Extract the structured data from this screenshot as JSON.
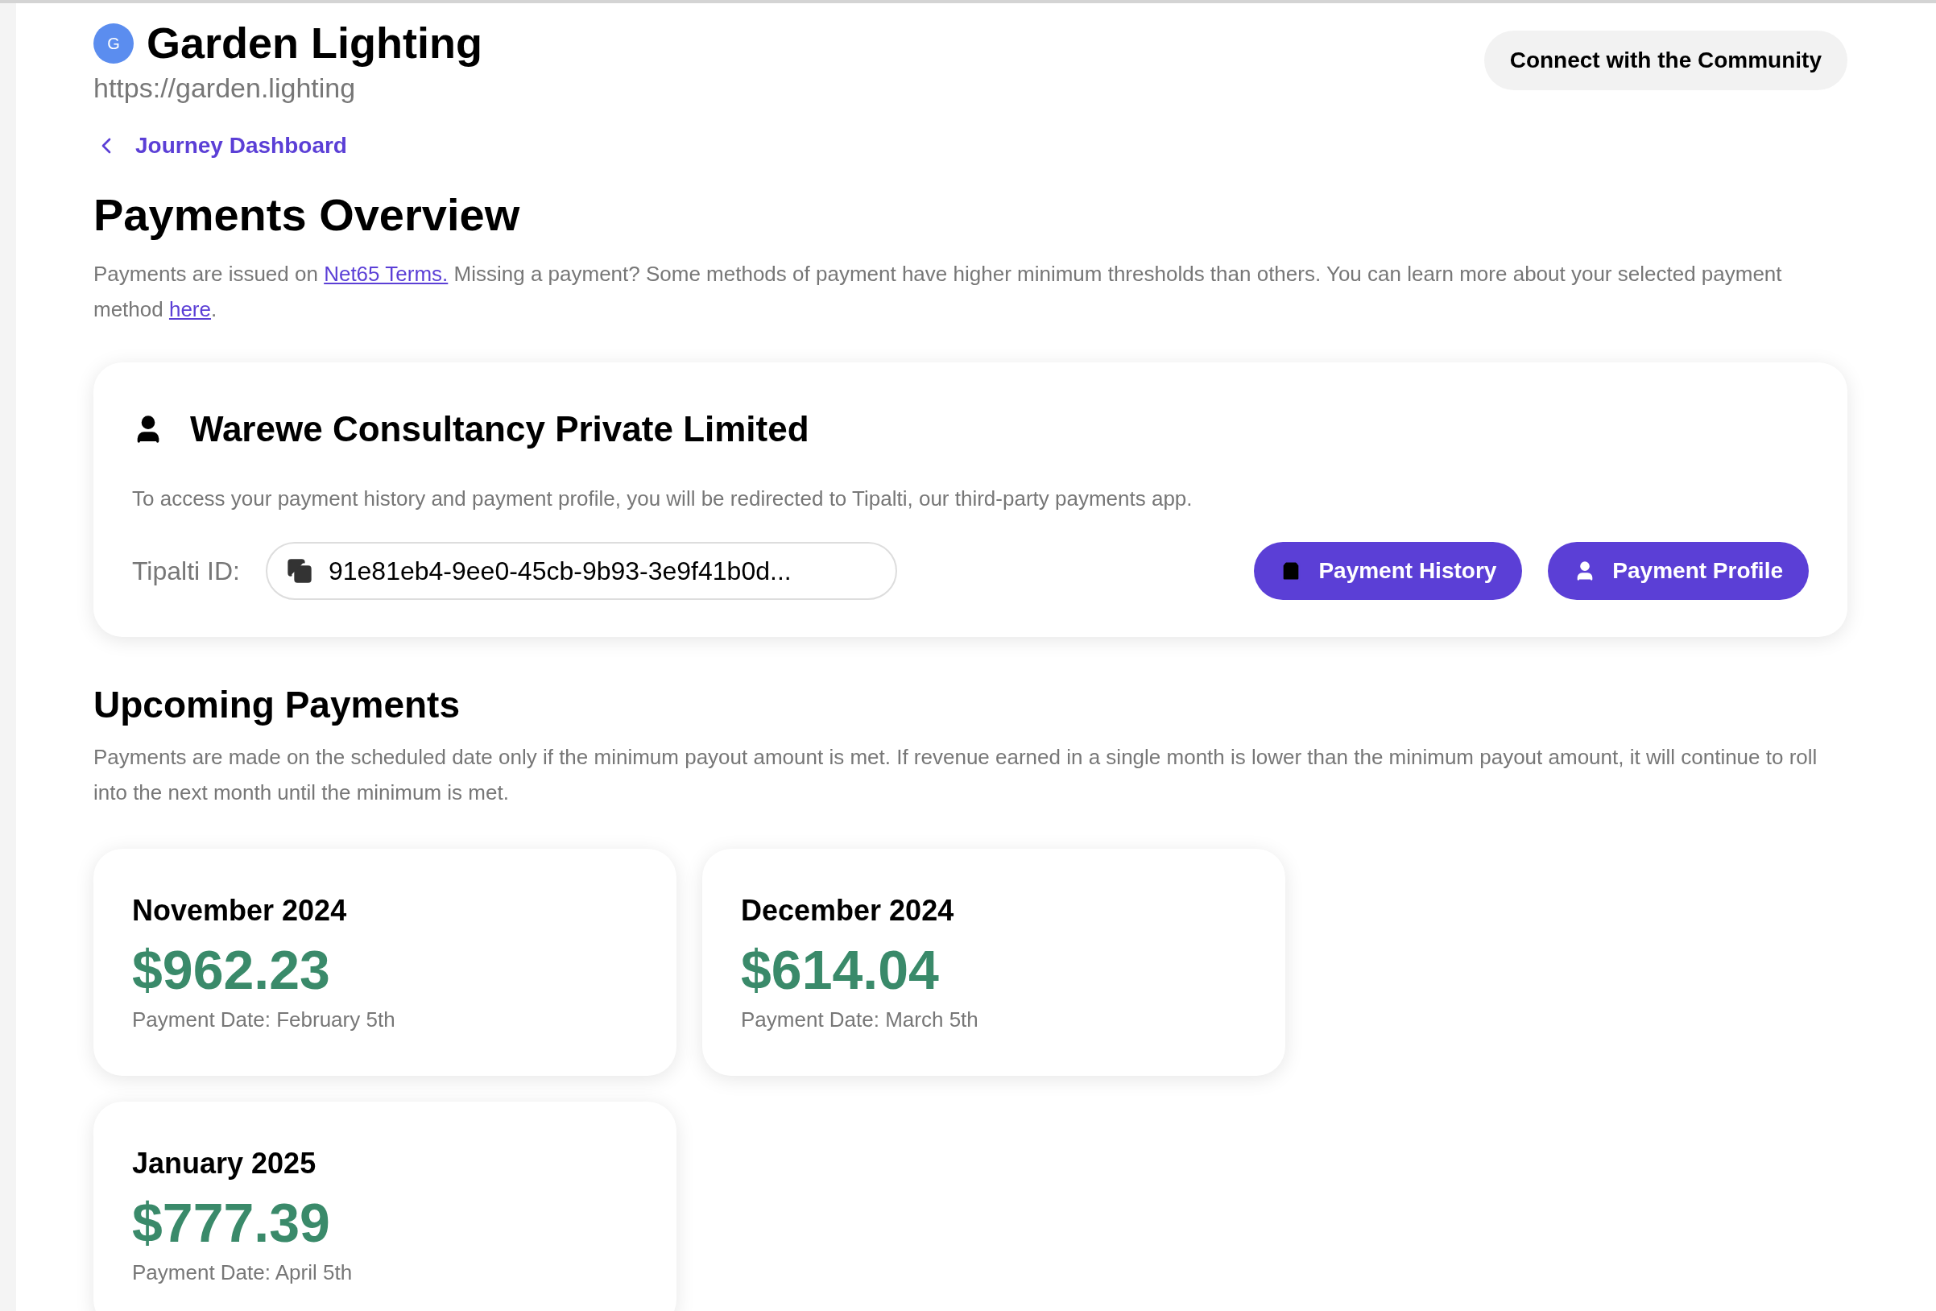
{
  "site": {
    "avatar_letter": "G",
    "name": "Garden Lighting",
    "url": "https://garden.lighting"
  },
  "community_button": "Connect with the Community",
  "back_link": "Journey Dashboard",
  "title": "Payments Overview",
  "intro": [
    {
      "kind": "text",
      "text": "Payments are issued on "
    },
    {
      "kind": "link",
      "text": "Net65 Terms."
    },
    {
      "kind": "text",
      "text": " Missing a payment? Some methods of payment have higher minimum thresholds than others. You can learn more about your selected payment method "
    },
    {
      "kind": "link",
      "text": "here"
    },
    {
      "kind": "text",
      "text": "."
    }
  ],
  "account": {
    "name": "Warewe Consultancy Private Limited",
    "note": "To access your payment history and payment profile, you will be redirected to Tipalti, our third-party payments app.",
    "id_label": "Tipalti ID:",
    "id_value": "91e81eb4-9ee0-45cb-9b93-3e9f41b0d...",
    "buttons": [
      {
        "kind": "history",
        "label": "Payment History"
      },
      {
        "kind": "profile",
        "label": "Payment Profile"
      }
    ]
  },
  "upcoming": {
    "title": "Upcoming Payments",
    "note": "Payments are made on the scheduled date only if the minimum payout amount is met. If revenue earned in a single month is lower than the minimum payout amount, it will continue to roll into the next month until the minimum is met.",
    "payments": [
      {
        "month": "November 2024",
        "amount": "$962.23",
        "date": "Payment Date: February 5th"
      },
      {
        "month": "December 2024",
        "amount": "$614.04",
        "date": "Payment Date: March 5th"
      },
      {
        "month": "January 2025",
        "amount": "$777.39",
        "date": "Payment Date: April 5th"
      }
    ]
  }
}
